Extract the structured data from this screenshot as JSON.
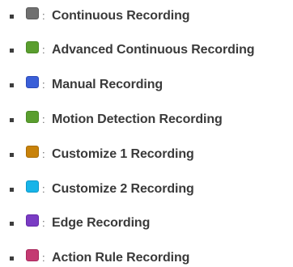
{
  "legend": {
    "separator": ":",
    "items": [
      {
        "label": "Continuous Recording",
        "color": "#707070",
        "swatch_border": "#5a5a5a",
        "icon": "continuous-recording-swatch-icon"
      },
      {
        "label": "Advanced Continuous Recording",
        "color": "#5a9e2e",
        "swatch_border": "#4a8a24",
        "icon": "advanced-continuous-recording-swatch-icon"
      },
      {
        "label": "Manual Recording",
        "color": "#3a5fd8",
        "swatch_border": "#2c4ab8",
        "icon": "manual-recording-swatch-icon"
      },
      {
        "label": "Motion Detection Recording",
        "color": "#5a9e2e",
        "swatch_border": "#4a8a24",
        "icon": "motion-detection-recording-swatch-icon"
      },
      {
        "label": "Customize 1 Recording",
        "color": "#c8820a",
        "swatch_border": "#a86c06",
        "icon": "customize-1-recording-swatch-icon"
      },
      {
        "label": "Customize 2 Recording",
        "color": "#17b4e8",
        "swatch_border": "#0e98c8",
        "icon": "customize-2-recording-swatch-icon"
      },
      {
        "label": "Edge Recording",
        "color": "#7a3cc4",
        "swatch_border": "#6428a8",
        "icon": "edge-recording-swatch-icon"
      },
      {
        "label": "Action Rule Recording",
        "color": "#c43a72",
        "swatch_border": "#a8285c",
        "icon": "action-rule-recording-swatch-icon"
      }
    ]
  }
}
